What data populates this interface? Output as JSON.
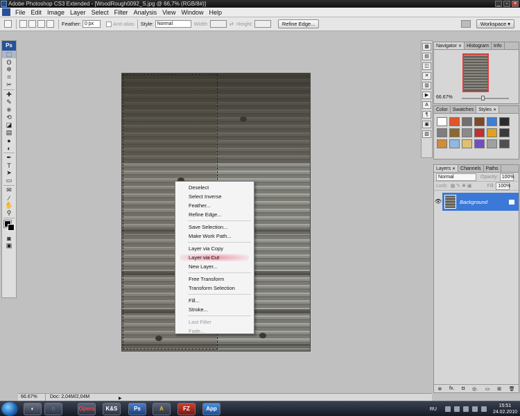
{
  "window": {
    "title": "Adobe Photoshop CS3 Extended - [WoodRough0092_S.jpg @ 66,7% (RGB/8#)]",
    "controls": [
      "_",
      "▫",
      "✕"
    ]
  },
  "menubar": {
    "items": [
      "File",
      "Edit",
      "Image",
      "Layer",
      "Select",
      "Filter",
      "Analysis",
      "View",
      "Window",
      "Help"
    ]
  },
  "options": {
    "feather_label": "Feather:",
    "feather_value": "0 px",
    "antialias_label": "Anti-alias",
    "style_label": "Style:",
    "style_value": "Normal",
    "width_label": "Width:",
    "height_label": "Height:",
    "refine_label": "Refine Edge...",
    "workspace_label": "Workspace ▾"
  },
  "toolbox": {
    "logo": "Ps",
    "tools": [
      "marquee-tool",
      "lasso-tool",
      "magic-wand-tool",
      "crop-tool",
      "slice-tool",
      "healing-tool",
      "brush-tool",
      "clone-stamp-tool",
      "history-brush-tool",
      "eraser-tool",
      "gradient-tool",
      "blur-tool",
      "dodge-tool",
      "pen-tool",
      "type-tool",
      "path-selection-tool",
      "shape-tool",
      "notes-tool",
      "eyedropper-tool",
      "hand-tool",
      "zoom-tool"
    ],
    "glyphs": [
      "⬚",
      "ʘ",
      "✲",
      "⌗",
      "✂",
      "✚",
      "✎",
      "⎈",
      "⟲",
      "◪",
      "▤",
      "●",
      "◐",
      "✒",
      "T",
      "➤",
      "▭",
      "✉",
      "⁄",
      "✋",
      "⚲"
    ]
  },
  "context_menu": {
    "groups": [
      [
        "Deselect",
        "Select Inverse",
        "Feather...",
        "Refine Edge..."
      ],
      [
        "Save Selection...",
        "Make Work Path..."
      ],
      [
        "Layer via Copy",
        "Layer via Cut",
        "New Layer..."
      ],
      [
        "Free Transform",
        "Transform Selection"
      ],
      [
        "Fill...",
        "Stroke..."
      ],
      [
        "Last Filter",
        "Fade..."
      ]
    ],
    "highlighted": "Layer via Cut",
    "disabled": [
      "Last Filter",
      "Fade..."
    ]
  },
  "statusbar": {
    "zoom": "66.67%",
    "doc_info": "Doc: 2,04M/2,04M"
  },
  "navigator_panel": {
    "tabs": [
      "Navigator",
      "Histogram",
      "Info"
    ],
    "zoom": "66.67%"
  },
  "styles_panel": {
    "tabs": [
      "Color",
      "Swatches",
      "Styles"
    ],
    "swatch_colors": [
      "#ffffff",
      "#e0552c",
      "#6f6f6f",
      "#7a4a2a",
      "#3f7fd0",
      "#2c2c2c",
      "#7f7f7f",
      "#8c6a2c",
      "#8a8a8a",
      "#c23030",
      "#e0a020",
      "#3a3a3a",
      "#d08c3a",
      "#90b8e0",
      "#e0c070",
      "#7050c0",
      "#a0a0a0",
      "#505050"
    ]
  },
  "layers_panel": {
    "tabs": [
      "Layers",
      "Channels",
      "Paths"
    ],
    "blend_mode": "Normal",
    "opacity_label": "Opacity:",
    "opacity_value": "100%",
    "lock_label": "Lock:",
    "fill_label": "Fill:",
    "fill_value": "100%",
    "layer_name": "Background",
    "footer_icons": [
      "⊛",
      "fx.",
      "◘",
      "◎.",
      "▭",
      "⊞",
      "🗑"
    ]
  },
  "taskbar": {
    "apps": [
      "Opera",
      "K&S",
      "Ps",
      "A",
      "FZ",
      "App"
    ],
    "lang": "RU",
    "time": "15:51",
    "date": "24.02.2010"
  }
}
